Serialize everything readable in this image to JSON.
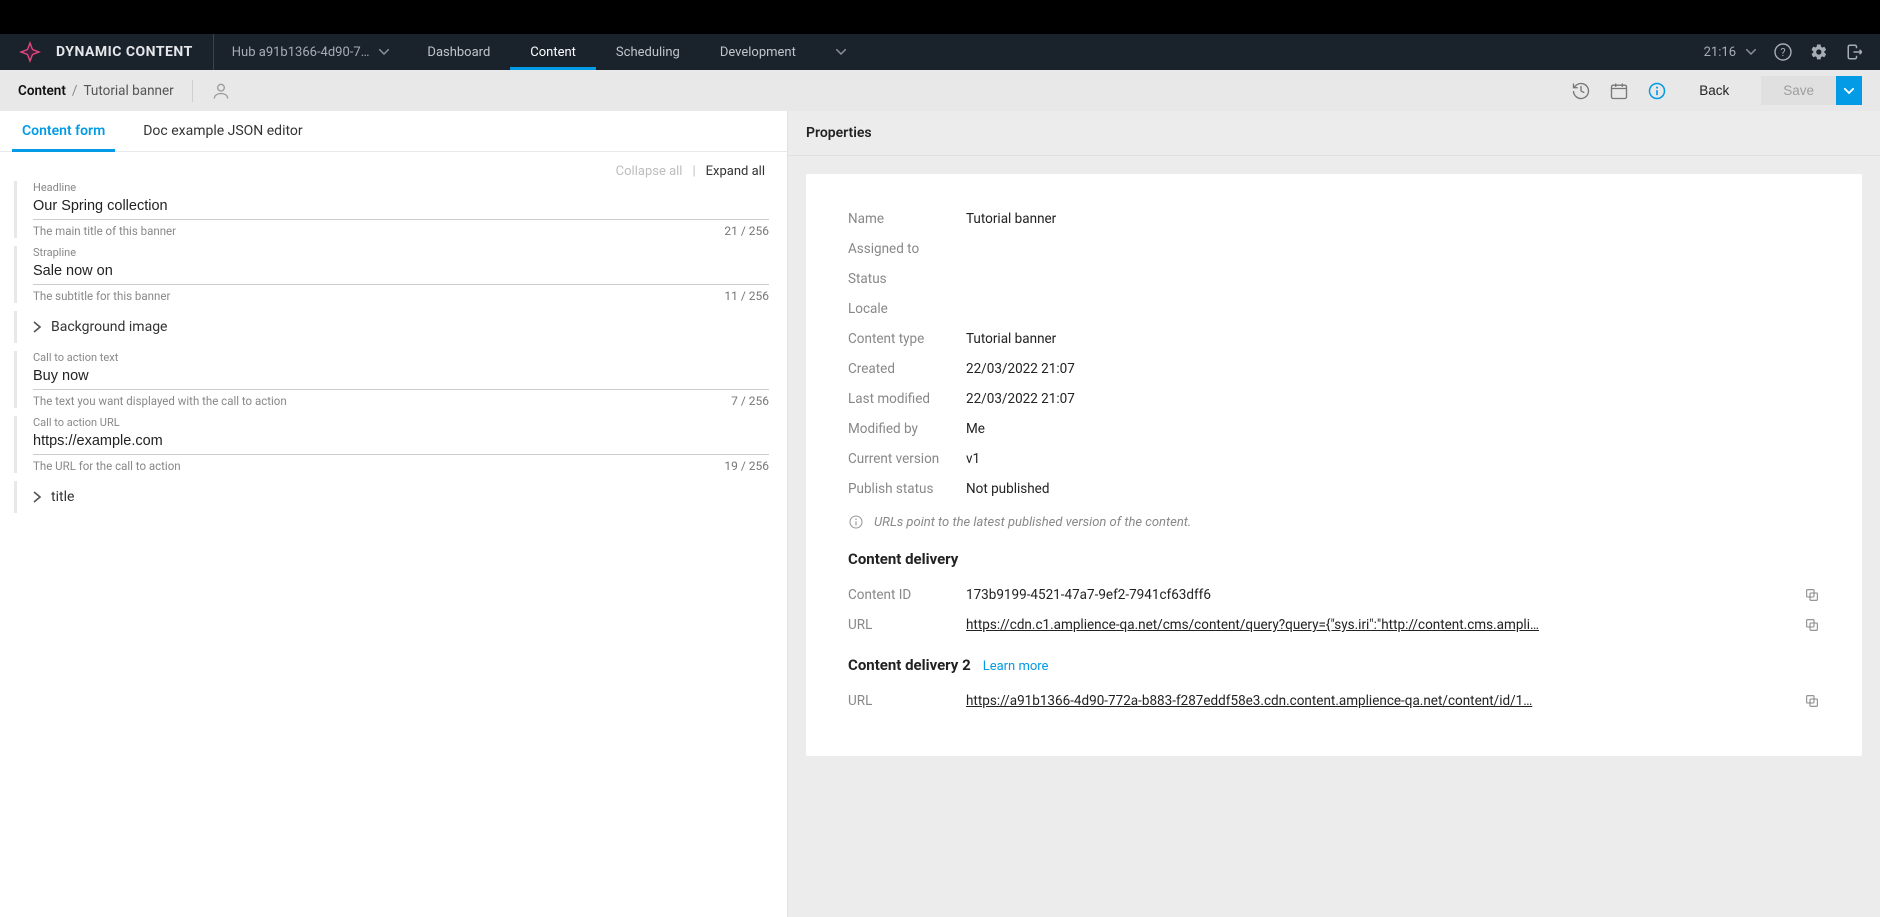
{
  "app": {
    "name": "DYNAMIC CONTENT",
    "hub": "Hub a91b1366-4d90-7…",
    "time": "21:16"
  },
  "nav": {
    "dashboard": "Dashboard",
    "content": "Content",
    "scheduling": "Scheduling",
    "development": "Development"
  },
  "breadcrumb": {
    "root": "Content",
    "leaf": "Tutorial banner"
  },
  "actions": {
    "back": "Back",
    "save": "Save"
  },
  "tabs": {
    "form": "Content form",
    "json": "Doc example JSON editor"
  },
  "expand": {
    "collapse": "Collapse all",
    "expand": "Expand all"
  },
  "fields": {
    "headline": {
      "label": "Headline",
      "value": "Our Spring collection",
      "hint": "The main title of this banner",
      "count": "21 / 256"
    },
    "strapline": {
      "label": "Strapline",
      "value": "Sale now on",
      "hint": "The subtitle for this banner",
      "count": "11 / 256"
    },
    "bgimage": {
      "label": "Background image"
    },
    "cta_text": {
      "label": "Call to action text",
      "value": "Buy now",
      "hint": "The text you want displayed with the call to action",
      "count": "7 / 256"
    },
    "cta_url": {
      "label": "Call to action URL",
      "value": "https://example.com",
      "hint": "The URL for the call to action",
      "count": "19 / 256"
    },
    "title": {
      "label": "title"
    }
  },
  "props": {
    "header": "Properties",
    "name_l": "Name",
    "name_v": "Tutorial banner",
    "assigned_l": "Assigned to",
    "assigned_v": "",
    "status_l": "Status",
    "status_v": "",
    "locale_l": "Locale",
    "locale_v": "",
    "type_l": "Content type",
    "type_v": "Tutorial banner",
    "created_l": "Created",
    "created_v": "22/03/2022 21:07",
    "modified_l": "Last modified",
    "modified_v": "22/03/2022 21:07",
    "modifiedby_l": "Modified by",
    "modifiedby_v": "Me",
    "version_l": "Current version",
    "version_v": "v1",
    "publish_l": "Publish status",
    "publish_v": "Not published",
    "url_note": "URLs point to the latest published version of the content."
  },
  "delivery": {
    "h1": "Content delivery",
    "id_l": "Content ID",
    "id_v": "173b9199-4521-47a7-9ef2-7941cf63dff6",
    "url_l": "URL",
    "url_v": "https://cdn.c1.amplience-qa.net/cms/content/query?query={\"sys.iri\":\"http://content.cms.ampli…",
    "h2": "Content delivery 2",
    "learn": "Learn more",
    "url2_l": "URL",
    "url2_v": "https://a91b1366-4d90-772a-b883-f287eddf58e3.cdn.content.amplience-qa.net/content/id/1…"
  }
}
